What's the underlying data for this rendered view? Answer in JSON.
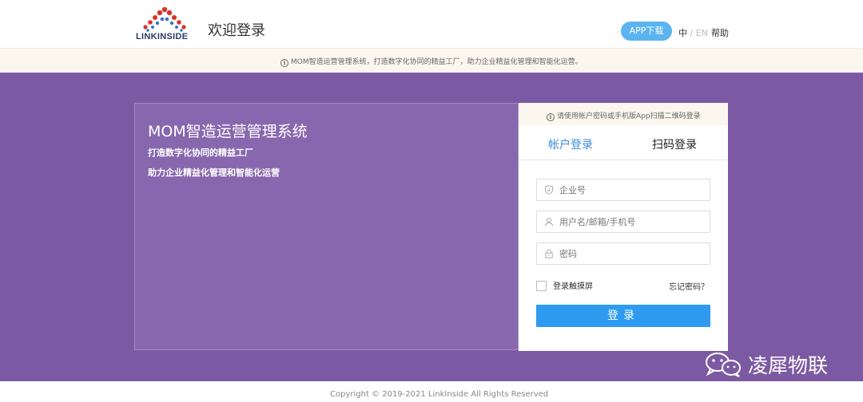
{
  "header": {
    "logo_text": "LINKINSIDE",
    "title": "欢迎登录",
    "app_download": "APP下载",
    "lang_zh": "中",
    "lang_sep": "/",
    "lang_en": "EN",
    "help": "帮助"
  },
  "notice": {
    "text": "MOM智造运营管理系统，打造数字化协同的精益工厂，助力企业精益化管理和智能化运营。"
  },
  "banner": {
    "title": "MOM智造运营管理系统",
    "line1": "打造数字化协同的精益工厂",
    "line2": "助力企业精益化管理和智能化运营"
  },
  "login": {
    "notice": "请使用帐户密码或手机版App扫描二维码登录",
    "tabs": [
      {
        "label": "帐户登录",
        "active": true
      },
      {
        "label": "扫码登录",
        "active": false
      }
    ],
    "fields": {
      "company": {
        "value": "",
        "placeholder": "企业号",
        "icon": "shield-icon"
      },
      "username": {
        "value": "",
        "placeholder": "用户名/邮箱/手机号",
        "icon": "user-icon"
      },
      "password": {
        "value": "",
        "placeholder": "密码",
        "icon": "lock-icon"
      }
    },
    "remember_label": "登录触摸屏",
    "forgot_label": "忘记密码？",
    "submit_label": "登录"
  },
  "watermark": {
    "text": "凌犀物联"
  },
  "footer": {
    "copyright": "Copyright © 2019-2021 LinkInside All Rights Reserved"
  },
  "colors": {
    "purple_band": "#7c5aa3",
    "left_panel": "#8767ad",
    "accent_blue": "#2e9bf0",
    "tab_active": "#3b8bd9",
    "app_button": "#5bb4f0"
  }
}
